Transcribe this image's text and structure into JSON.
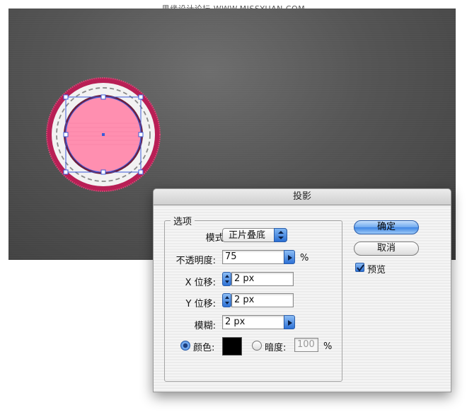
{
  "watermark": "思缘设计论坛 WWW.MISSYUAN.COM",
  "dialog": {
    "title": "投影",
    "group_label": "选项",
    "mode": {
      "label": "模式:",
      "value": "正片叠底"
    },
    "opacity": {
      "label": "不透明度:",
      "value": "75",
      "unit": "%"
    },
    "x_offset": {
      "label": "X 位移:",
      "value": "2 px"
    },
    "y_offset": {
      "label": "Y 位移:",
      "value": "2 px"
    },
    "blur": {
      "label": "模糊:",
      "value": "2 px"
    },
    "color_option": {
      "label": "颜色:",
      "selected": true,
      "swatch": "#000000"
    },
    "darkness_option": {
      "label": "暗度:",
      "value": "100",
      "unit": "%"
    },
    "buttons": {
      "ok": "确定",
      "cancel": "取消"
    },
    "preview": {
      "label": "预览",
      "checked": true
    }
  },
  "colors": {
    "badge_outer": "#c2285c",
    "badge_inner": "#ff8fb0",
    "selection": "#3a5bd9",
    "accent_blue": "#3f86e4"
  }
}
